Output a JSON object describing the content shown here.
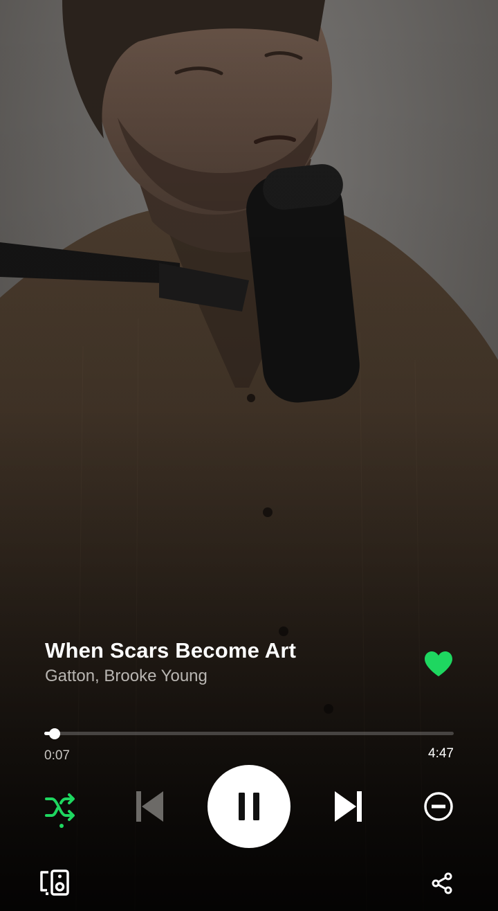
{
  "track": {
    "title": "When Scars Become Art",
    "artists": "Gatton, Brooke Young",
    "liked": true
  },
  "playback": {
    "elapsed": "0:07",
    "duration": "4:47",
    "progress_fraction": 0.025,
    "state": "playing",
    "shuffle": true
  },
  "icons": {
    "like": "heart-icon",
    "shuffle": "shuffle-icon",
    "previous": "skip-previous-icon",
    "pause": "pause-icon",
    "next": "skip-next-icon",
    "hide": "minus-circle-icon",
    "devices": "connect-devices-icon",
    "share": "share-icon"
  },
  "colors": {
    "accent": "#1ed760",
    "primary_text": "#ffffff",
    "secondary_text": "#b9b6b2",
    "play_button": "#ffffff"
  }
}
